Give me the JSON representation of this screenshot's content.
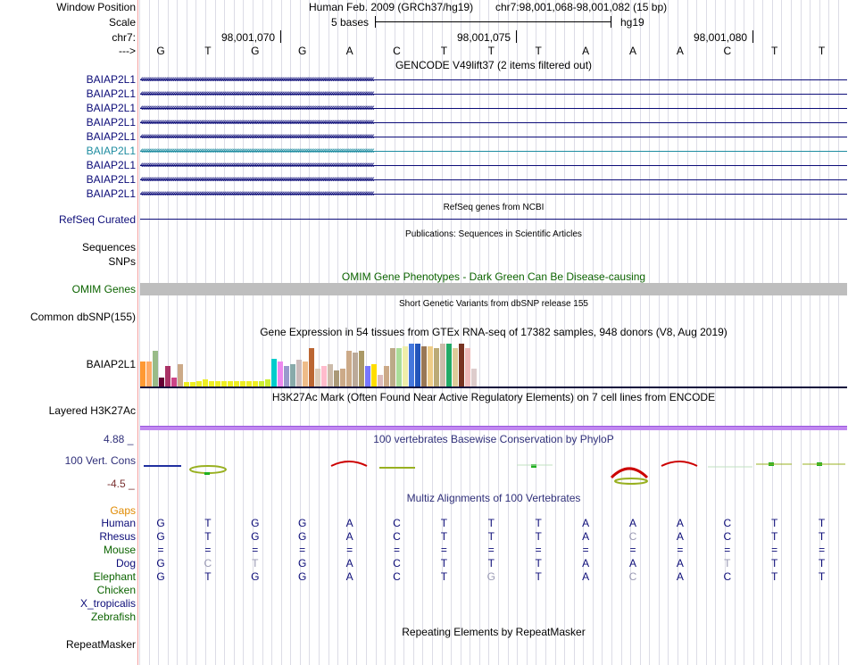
{
  "header": {
    "window_position_label": "Window Position",
    "assembly": "Human Feb. 2009 (GRCh37/hg19)",
    "position": "chr7:98,001,068-98,001,082 (15 bp)",
    "scale_label": "Scale",
    "scale_text": "5 bases",
    "scale_db": "hg19",
    "chrom_label": "chr7:",
    "coord_ticks": [
      "98,001,070",
      "98,001,075",
      "98,001,080"
    ],
    "strand_label": "--->",
    "bases": [
      "G",
      "T",
      "G",
      "G",
      "A",
      "C",
      "T",
      "T",
      "T",
      "A",
      "A",
      "A",
      "C",
      "T",
      "T"
    ]
  },
  "gencode": {
    "title": "GENCODE V49lift37 (2 items filtered out)",
    "items": [
      {
        "label": "BAIAP2L1",
        "color": "#0c0c78"
      },
      {
        "label": "BAIAP2L1",
        "color": "#0c0c78"
      },
      {
        "label": "BAIAP2L1",
        "color": "#0c0c78"
      },
      {
        "label": "BAIAP2L1",
        "color": "#0c0c78"
      },
      {
        "label": "BAIAP2L1",
        "color": "#0c0c78"
      },
      {
        "label": "BAIAP2L1",
        "color": "#1e8ca0"
      },
      {
        "label": "BAIAP2L1",
        "color": "#0c0c78"
      },
      {
        "label": "BAIAP2L1",
        "color": "#0c0c78"
      },
      {
        "label": "BAIAP2L1",
        "color": "#0c0c78"
      }
    ]
  },
  "refseq": {
    "title": "RefSeq genes from NCBI",
    "label": "RefSeq Curated"
  },
  "pubs": {
    "title": "Publications: Sequences in Scientific Articles",
    "label_sequences": "Sequences",
    "label_snps": "SNPs"
  },
  "omim": {
    "title": "OMIM Gene Phenotypes - Dark Green Can Be Disease-causing",
    "label": "OMIM Genes"
  },
  "dbsnp": {
    "title": "Short Genetic Variants from dbSNP release 155",
    "label": "Common dbSNP(155)"
  },
  "gtex": {
    "title": "Gene Expression in 54 tissues from GTEx RNA-seq of 17382 samples, 948 donors (V8, Aug 2019)",
    "label": "BAIAP2L1",
    "levels": [
      0.55,
      0.55,
      0.8,
      0.2,
      0.45,
      0.2,
      0.5,
      0.1,
      0.1,
      0.12,
      0.15,
      0.12,
      0.12,
      0.12,
      0.12,
      0.12,
      0.12,
      0.12,
      0.12,
      0.12,
      0.15,
      0.62,
      0.55,
      0.45,
      0.5,
      0.6,
      0.55,
      0.85,
      0.4,
      0.45,
      0.5,
      0.35,
      0.4,
      0.8,
      0.75,
      0.8,
      0.45,
      0.5,
      0.25,
      0.45,
      0.85,
      0.85,
      0.9,
      0.95,
      0.95,
      0.9,
      0.9,
      0.85,
      0.95,
      0.95,
      0.85,
      0.95,
      0.85,
      0.4
    ],
    "colors": [
      "#ff9933",
      "#ffaa66",
      "#99bb88",
      "#660033",
      "#aa3366",
      "#cc4488",
      "#ccaa88",
      "#eeee22",
      "#eeee22",
      "#eeee22",
      "#eeee22",
      "#eeee22",
      "#eeee22",
      "#eeee22",
      "#eeee22",
      "#eeee22",
      "#eeee22",
      "#eeee22",
      "#eeee22",
      "#ccee33",
      "#ccee33",
      "#00cccc",
      "#ee88ee",
      "#9999cc",
      "#88aaaa",
      "#ccbbbb",
      "#eebb88",
      "#bb6633",
      "#ddccbb",
      "#ffbbcc",
      "#ccbbaa",
      "#aa9977",
      "#ccaa88",
      "#ccaa88",
      "#bbaa99",
      "#aa9966",
      "#7777ff",
      "#ffdd00",
      "#ddbbbb",
      "#ccaa88",
      "#bbaa88",
      "#aadd99",
      "#eeeeaa",
      "#4477dd",
      "#2255bb",
      "#997755",
      "#eecc88",
      "#bbaa77",
      "#ccbbaa",
      "#22aa66",
      "#ddcc99",
      "#773322",
      "#eebbbb",
      "#ddcccc"
    ]
  },
  "h3k27ac": {
    "title": "H3K27Ac Mark (Often Found Near Active Regulatory Elements) on 7 cell lines from ENCODE",
    "label": "Layered H3K27Ac"
  },
  "phylop": {
    "title": "100 vertebrates Basewise Conservation by PhyloP",
    "label": "100 Vert. Cons",
    "max": "4.88 _",
    "min": "-4.5 _"
  },
  "multiz": {
    "title": "Multiz Alignments of 100 Vertebrates",
    "gaps_label": "Gaps",
    "species": [
      {
        "name": "Human",
        "color": "#0c0c78",
        "bases": [
          "G",
          "T",
          "G",
          "G",
          "A",
          "C",
          "T",
          "T",
          "T",
          "A",
          "A",
          "A",
          "C",
          "T",
          "T"
        ],
        "faded": []
      },
      {
        "name": "Rhesus",
        "color": "#0c0c78",
        "bases": [
          "G",
          "T",
          "G",
          "G",
          "A",
          "C",
          "T",
          "T",
          "T",
          "A",
          "C",
          "A",
          "C",
          "T",
          "T"
        ],
        "faded": [
          10
        ]
      },
      {
        "name": "Mouse",
        "color": "#0c6400",
        "bases": [
          "=",
          "=",
          "=",
          "=",
          "=",
          "=",
          "=",
          "=",
          "=",
          "=",
          "=",
          "=",
          "=",
          "=",
          "="
        ],
        "faded": []
      },
      {
        "name": "Dog",
        "color": "#0c0c78",
        "bases": [
          "G",
          "C",
          "T",
          "G",
          "A",
          "C",
          "T",
          "T",
          "T",
          "A",
          "A",
          "A",
          "T",
          "T",
          "T"
        ],
        "faded": [
          1,
          2,
          12
        ]
      },
      {
        "name": "Elephant",
        "color": "#0c6400",
        "bases": [
          "G",
          "T",
          "G",
          "G",
          "A",
          "C",
          "T",
          "G",
          "T",
          "A",
          "C",
          "A",
          "C",
          "T",
          "T"
        ],
        "faded": [
          7,
          10
        ]
      },
      {
        "name": "Chicken",
        "color": "#0c6400",
        "bases": [],
        "faded": []
      },
      {
        "name": "X_tropicalis",
        "color": "#0c0c78",
        "bases": [],
        "faded": []
      },
      {
        "name": "Zebrafish",
        "color": "#0c6400",
        "bases": [],
        "faded": []
      }
    ]
  },
  "repeatmasker": {
    "title": "Repeating Elements by RepeatMasker",
    "label": "RepeatMasker"
  }
}
